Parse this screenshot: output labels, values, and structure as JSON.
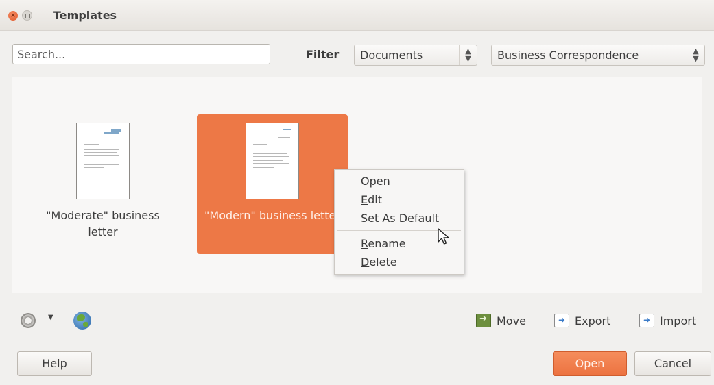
{
  "window": {
    "title": "Templates"
  },
  "toolbar": {
    "search_placeholder": "Search...",
    "filter_label": "Filter",
    "filter_type": "Documents",
    "filter_category": "Business Correspondence"
  },
  "templates": [
    {
      "label": "\"Moderate\" business letter",
      "selected": false
    },
    {
      "label": "\"Modern\" business letter",
      "selected": true
    }
  ],
  "context_menu": {
    "items": [
      {
        "mnemonic": "O",
        "rest": "pen"
      },
      {
        "mnemonic": "E",
        "rest": "dit"
      },
      {
        "mnemonic": "S",
        "rest": "et As Default"
      },
      {
        "mnemonic": "R",
        "rest": "ename"
      },
      {
        "mnemonic": "D",
        "rest": "elete"
      }
    ]
  },
  "actions": {
    "move": "Move",
    "export": "Export",
    "import": "Import"
  },
  "buttons": {
    "help": "Help",
    "open": "Open",
    "cancel": "Cancel"
  },
  "colors": {
    "accent": "#ed7846",
    "primary_button": "#ec7240"
  },
  "icons": [
    "close-icon",
    "maximize-icon",
    "settings-gear-icon",
    "dropdown-arrow-icon",
    "online-repository-globe-icon",
    "move-icon",
    "export-icon",
    "import-icon",
    "mouse-cursor-icon"
  ]
}
